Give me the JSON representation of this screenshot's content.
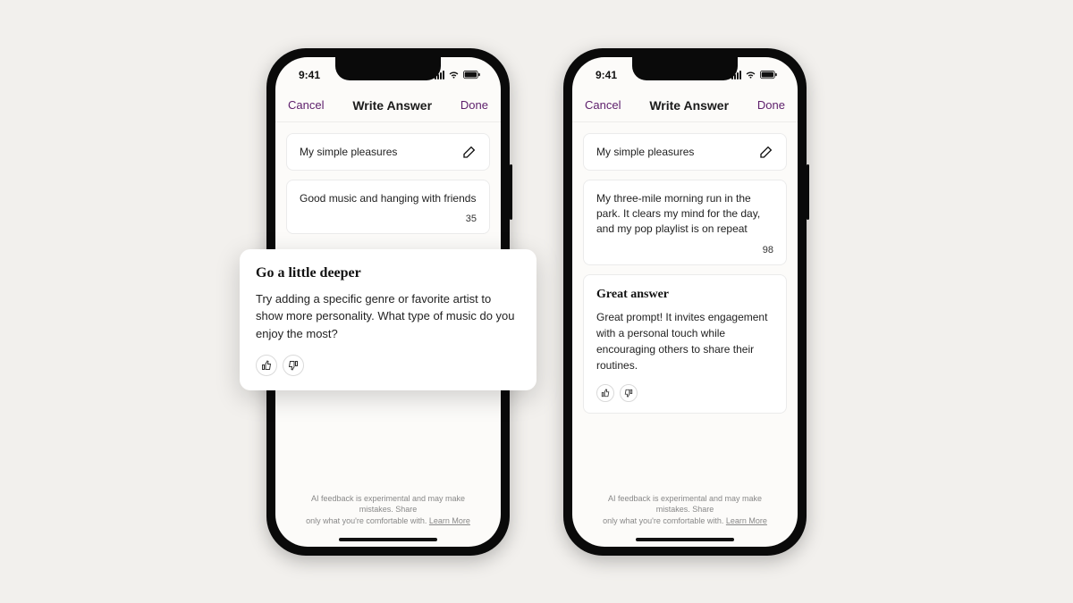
{
  "status": {
    "time": "9:41"
  },
  "phones": [
    {
      "nav": {
        "cancel": "Cancel",
        "title": "Write Answer",
        "done": "Done"
      },
      "prompt": "My simple pleasures",
      "answer": "Good music and hanging with friends",
      "count": "35",
      "feedback": {
        "title": "Go a little deeper",
        "body": "Try adding a specific genre or favorite artist to show more personality. What type of music do you enjoy the most?"
      },
      "disclaimer": {
        "line1": "AI feedback is experimental and may make mistakes. Share",
        "line2": "only what you're comfortable with.",
        "learn": "Learn More"
      }
    },
    {
      "nav": {
        "cancel": "Cancel",
        "title": "Write Answer",
        "done": "Done"
      },
      "prompt": "My simple pleasures",
      "answer": "My three-mile morning run in the park. It clears my mind for the day, and my pop playlist is on repeat",
      "count": "98",
      "feedback": {
        "title": "Great answer",
        "body": "Great prompt! It invites engagement with a personal touch while encouraging others to share their routines."
      },
      "disclaimer": {
        "line1": "AI feedback is experimental and may make mistakes. Share",
        "line2": "only what you're comfortable with.",
        "learn": "Learn More"
      }
    }
  ]
}
